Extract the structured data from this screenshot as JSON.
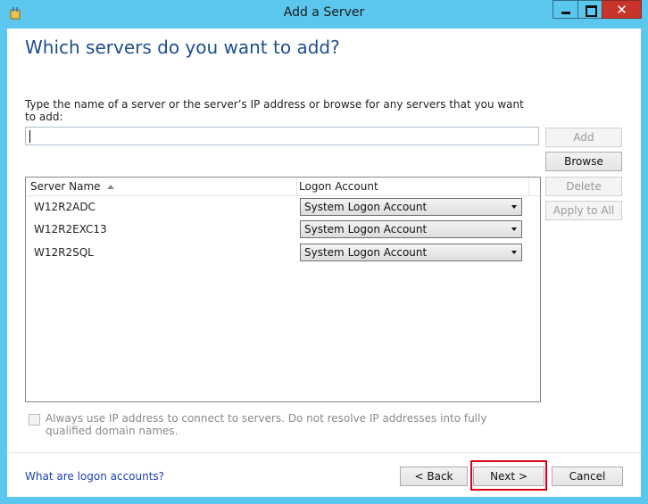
{
  "window": {
    "title": "Add a Server"
  },
  "heading": "Which servers do you want to add?",
  "instruction": "Type the name of a server or the server’s IP address or browse for any servers that you want to add:",
  "server_input": {
    "value": "",
    "placeholder": ""
  },
  "side_buttons": {
    "add": "Add",
    "browse": "Browse",
    "delete": "Delete",
    "apply_to_all": "Apply to All"
  },
  "table": {
    "columns": [
      "Server Name",
      "Logon Account"
    ],
    "rows": [
      {
        "name": "W12R2ADC",
        "account": "System Logon Account"
      },
      {
        "name": "W12R2EXC13",
        "account": "System Logon Account"
      },
      {
        "name": "W12R2SQL",
        "account": "System Logon Account"
      }
    ]
  },
  "option": {
    "label": "Always use IP address to connect to servers. Do not resolve IP addresses into fully qualified domain names.",
    "checked": false
  },
  "footer": {
    "link": "What are logon accounts?",
    "back": "< Back",
    "next": "Next >",
    "cancel": "Cancel"
  },
  "colors": {
    "titlebar": "#5bc6ee",
    "close": "#c7342a",
    "heading": "#1e4e8c",
    "link": "#1a3fb0",
    "highlight": "#e0001a"
  }
}
